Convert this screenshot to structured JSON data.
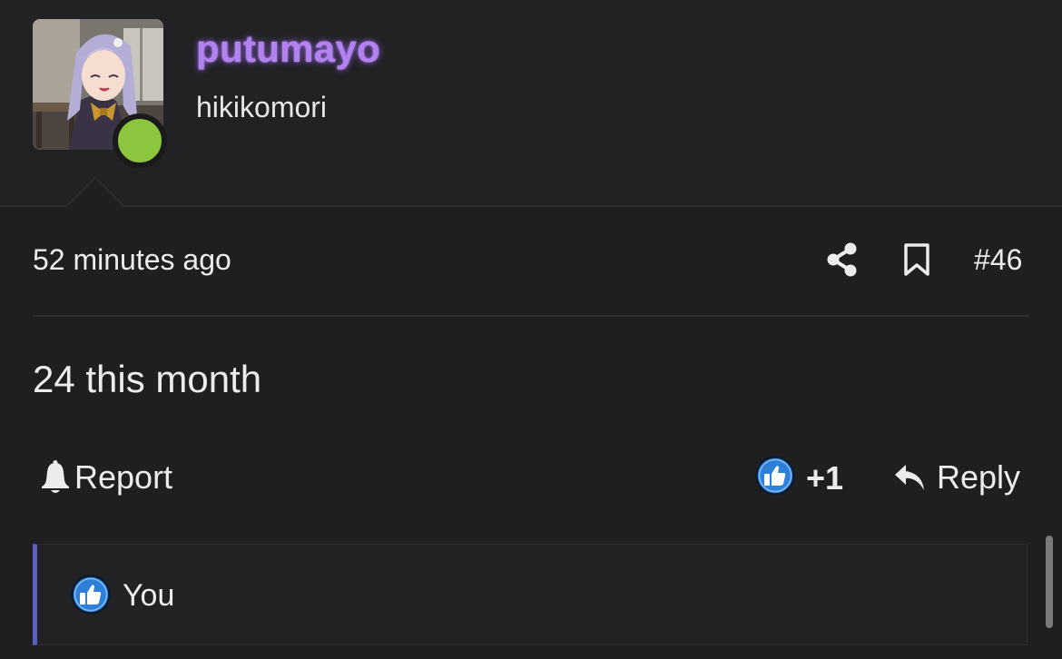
{
  "user": {
    "username": "putumayo",
    "title": "hikikomori",
    "online": true
  },
  "post": {
    "time": "52 minutes ago",
    "number": "#46",
    "body": "24 this month"
  },
  "actions": {
    "report_label": "Report",
    "reaction_count": "+1",
    "reply_label": "Reply"
  },
  "reactions": {
    "users": [
      "You"
    ]
  },
  "icons": {
    "share": "share-icon",
    "bookmark": "bookmark-icon",
    "report": "bell-icon",
    "like": "thumbs-up-icon",
    "reply": "reply-arrow-icon"
  },
  "colors": {
    "background": "#1f1f20",
    "username": "#b282f0",
    "online": "#8cc63e",
    "like_badge": "#2d7fd8",
    "reaction_accent": "#5b5fbf",
    "text": "#ececec"
  }
}
